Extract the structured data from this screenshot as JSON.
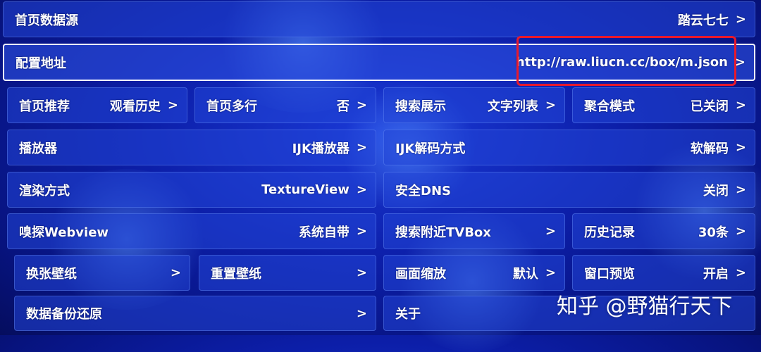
{
  "rows": [
    {
      "label": "首页数据源",
      "value": "踏云七七"
    },
    {
      "label": "配置地址",
      "value": "http://raw.liucn.cc/box/m.json"
    },
    {
      "label": "首页推荐",
      "value": "观看历史"
    },
    {
      "label": "首页多行",
      "value": "否"
    },
    {
      "label": "搜索展示",
      "value": "文字列表"
    },
    {
      "label": "聚合模式",
      "value": "已关闭"
    },
    {
      "label": "播放器",
      "value": "IJK播放器"
    },
    {
      "label": "IJK解码方式",
      "value": "软解码"
    },
    {
      "label": "渲染方式",
      "value": "TextureView"
    },
    {
      "label": "安全DNS",
      "value": "关闭"
    },
    {
      "label": "嗅探Webview",
      "value": "系统自带"
    },
    {
      "label": "搜索附近TVBox",
      "value": ""
    },
    {
      "label": "历史记录",
      "value": "30条"
    },
    {
      "label": "换张壁纸",
      "value": ""
    },
    {
      "label": "重置壁纸",
      "value": ""
    },
    {
      "label": "画面缩放",
      "value": "默认"
    },
    {
      "label": "窗口预览",
      "value": "开启"
    },
    {
      "label": "数据备份还原",
      "value": ""
    },
    {
      "label": "关于",
      "value": ""
    }
  ],
  "chevron": ">",
  "watermark": "知乎 @野猫行天下",
  "colors": {
    "background": "#0c1ea8",
    "highlight": "#e8192c",
    "focus_border": "#f4f6ff"
  }
}
